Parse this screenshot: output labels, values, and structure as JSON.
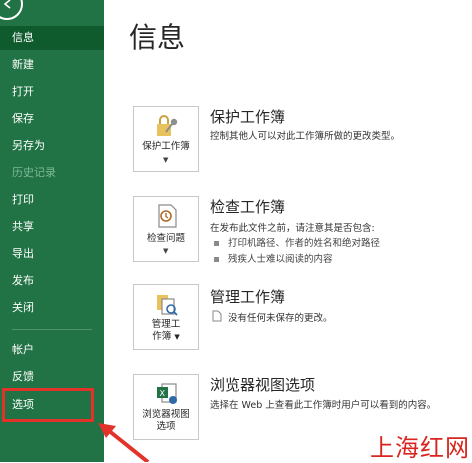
{
  "sidebar": {
    "items": [
      {
        "label": "信息"
      },
      {
        "label": "新建"
      },
      {
        "label": "打开"
      },
      {
        "label": "保存"
      },
      {
        "label": "另存为"
      },
      {
        "label": "历史记录"
      },
      {
        "label": "打印"
      },
      {
        "label": "共享"
      },
      {
        "label": "导出"
      },
      {
        "label": "发布"
      },
      {
        "label": "关闭"
      },
      {
        "label": "帐户"
      },
      {
        "label": "反馈"
      },
      {
        "label": "选项"
      }
    ],
    "active_index": 0,
    "disabled_index": 5,
    "highlight_color": "#e2332a",
    "bg_color": "#217346"
  },
  "main": {
    "title": "信息",
    "sections": [
      {
        "tile_label": "保护工作簿",
        "title": "保护工作簿",
        "desc": "控制其他人可以对此工作簿所做的更改类型。",
        "icon": "lock-key-icon"
      },
      {
        "tile_label": "检查问题",
        "title": "检查工作簿",
        "desc": "在发布此文件之前，请注意其是否包含:",
        "bullets": [
          "打印机路径、作者的姓名和绝对路径",
          "残疾人士难以阅读的内容"
        ],
        "icon": "inspect-document-icon"
      },
      {
        "tile_label_line1": "管理工",
        "tile_label_line2": "作簿",
        "title": "管理工作簿",
        "desc": "没有任何未保存的更改。",
        "icon": "manage-workbook-icon"
      },
      {
        "tile_label_line1": "浏览器视图",
        "tile_label_line2": "选项",
        "title": "浏览器视图选项",
        "desc": "选择在 Web 上查看此工作簿时用户可以看到的内容。",
        "icon": "excel-browser-icon"
      }
    ]
  },
  "watermark": "上海红网"
}
